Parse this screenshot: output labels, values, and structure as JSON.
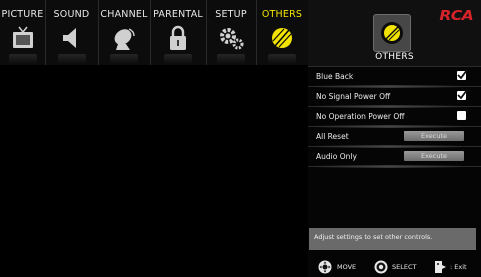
{
  "tabs": [
    {
      "label": "PICTURE",
      "icon": "tv-icon",
      "active": false
    },
    {
      "label": "SOUND",
      "icon": "speaker-icon",
      "active": false
    },
    {
      "label": "CHANNEL",
      "icon": "satellite-dish-icon",
      "active": false
    },
    {
      "label": "PARENTAL",
      "icon": "padlock-icon",
      "active": false
    },
    {
      "label": "SETUP",
      "icon": "gears-icon",
      "active": false
    },
    {
      "label": "OTHERS",
      "icon": "others-icon",
      "active": true
    }
  ],
  "brand": {
    "logo_text": "RCA",
    "logo_color": "#d8232a"
  },
  "panel": {
    "title": "OTHERS",
    "icon": "others-icon",
    "items": [
      {
        "label": "Blue Back",
        "control": "checkbox",
        "checked": true
      },
      {
        "label": "No Signal Power Off",
        "control": "checkbox",
        "checked": true
      },
      {
        "label": "No Operation Power Off",
        "control": "checkbox",
        "checked": false
      },
      {
        "label": "All Reset",
        "control": "button",
        "button_label": "Execute"
      },
      {
        "label": "Audio Only",
        "control": "button",
        "button_label": "Execute"
      }
    ],
    "hint": "Adjust settings to set other controls."
  },
  "footer": {
    "move_label": "MOVE",
    "select_label": "SELECT",
    "exit_label": ": Exit"
  },
  "colors": {
    "active_tab": "#f2e300",
    "background": "#000000"
  }
}
